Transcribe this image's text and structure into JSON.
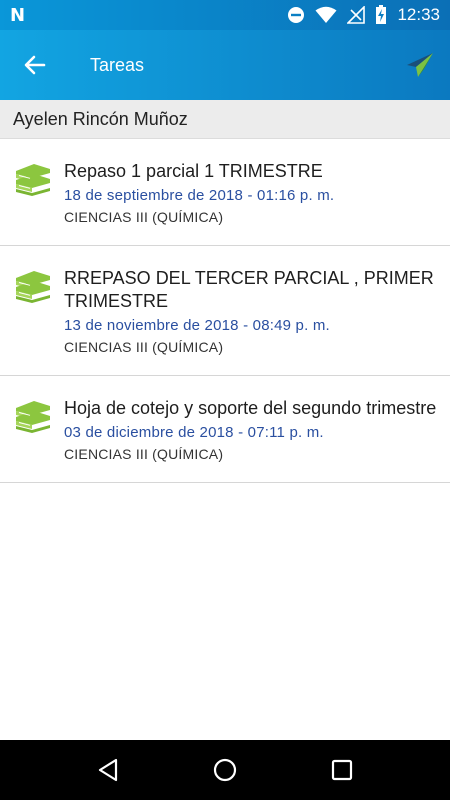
{
  "status": {
    "logo": "N",
    "time": "12:33"
  },
  "appbar": {
    "title": "Tareas"
  },
  "student": {
    "name": "Ayelen Rincón Muñoz"
  },
  "tasks": [
    {
      "title": "Repaso 1 parcial 1 TRIMESTRE",
      "date": "18 de septiembre de 2018 - 01:16 p. m.",
      "subject": "CIENCIAS III (QUÍMICA)"
    },
    {
      "title": "RREPASO DEL TERCER PARCIAL , PRIMER TRIMESTRE",
      "date": "13 de noviembre de 2018 - 08:49 p. m.",
      "subject": "CIENCIAS III (QUÍMICA)"
    },
    {
      "title": "Hoja de cotejo y soporte del segundo trimestre",
      "date": "03 de diciembre de 2018 - 07:11 p. m.",
      "subject": "CIENCIAS III (QUÍMICA)"
    }
  ],
  "icons": {
    "book": "book-stack-icon",
    "back": "arrow-back-icon",
    "send": "paper-plane-icon"
  },
  "colors": {
    "appbar": "#0b79c0",
    "book_green": "#8cc63f",
    "date_blue": "#2a4fa0"
  }
}
